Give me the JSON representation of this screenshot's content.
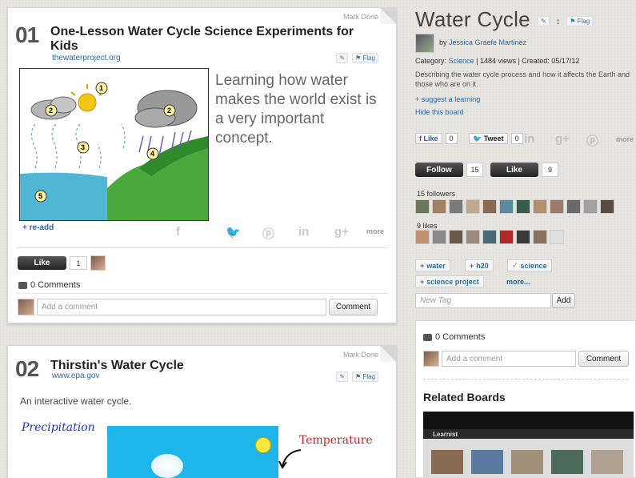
{
  "card1": {
    "mark_done": "Mark Done",
    "number": "01",
    "title": "One-Lesson Water Cycle Science Experiments for Kids",
    "source": "thewaterproject.org",
    "flag": "Flag",
    "quote": "Learning how water makes the world exist is a very important concept.",
    "readd": "+ re-add",
    "more": "more",
    "like_label": "Like",
    "like_count": "1",
    "comments_label": "0 Comments",
    "comment_placeholder": "Add a comment",
    "comment_button": "Comment"
  },
  "card2": {
    "mark_done": "Mark Done",
    "number": "02",
    "title": "Thirstin's Water Cycle",
    "source": "www.epa.gov",
    "flag": "Flag",
    "description": "An interactive water cycle.",
    "image_label_left": "Precipitation",
    "image_label_right": "Temperature"
  },
  "board": {
    "title": "Water Cycle",
    "flag": "Flag",
    "by": "by",
    "author": "Jessica Graefe Martinez",
    "category_prefix": "Category:",
    "category": "Science",
    "stats": "| 1484 views | Created: 05/17/12",
    "description": "Describing the water cycle process and how it affects the Earth and those who are on it.",
    "suggest": "+ suggest a learning",
    "hide": "Hide this board",
    "fb_like": "Like",
    "fb_count": "0",
    "tweet": "Tweet",
    "tweet_count": "0",
    "more": "more",
    "follow_label": "Follow",
    "follow_count": "15",
    "like_label": "Like",
    "like_count": "9",
    "followers_label": "15 followers",
    "likes_label": "9 likes",
    "tags": [
      "water",
      "h20",
      "science",
      "science project"
    ],
    "tags_more": "more...",
    "new_tag_placeholder": "New Tag",
    "add_button": "Add"
  },
  "panel": {
    "comments_label": "0 Comments",
    "comment_placeholder": "Add a comment",
    "comment_button": "Comment",
    "related_title": "Related Boards",
    "related_brand": "Learnist"
  },
  "colors": {
    "link": "#2c6aa0",
    "background": "#e6e4df",
    "accent_dark": "#222222"
  }
}
